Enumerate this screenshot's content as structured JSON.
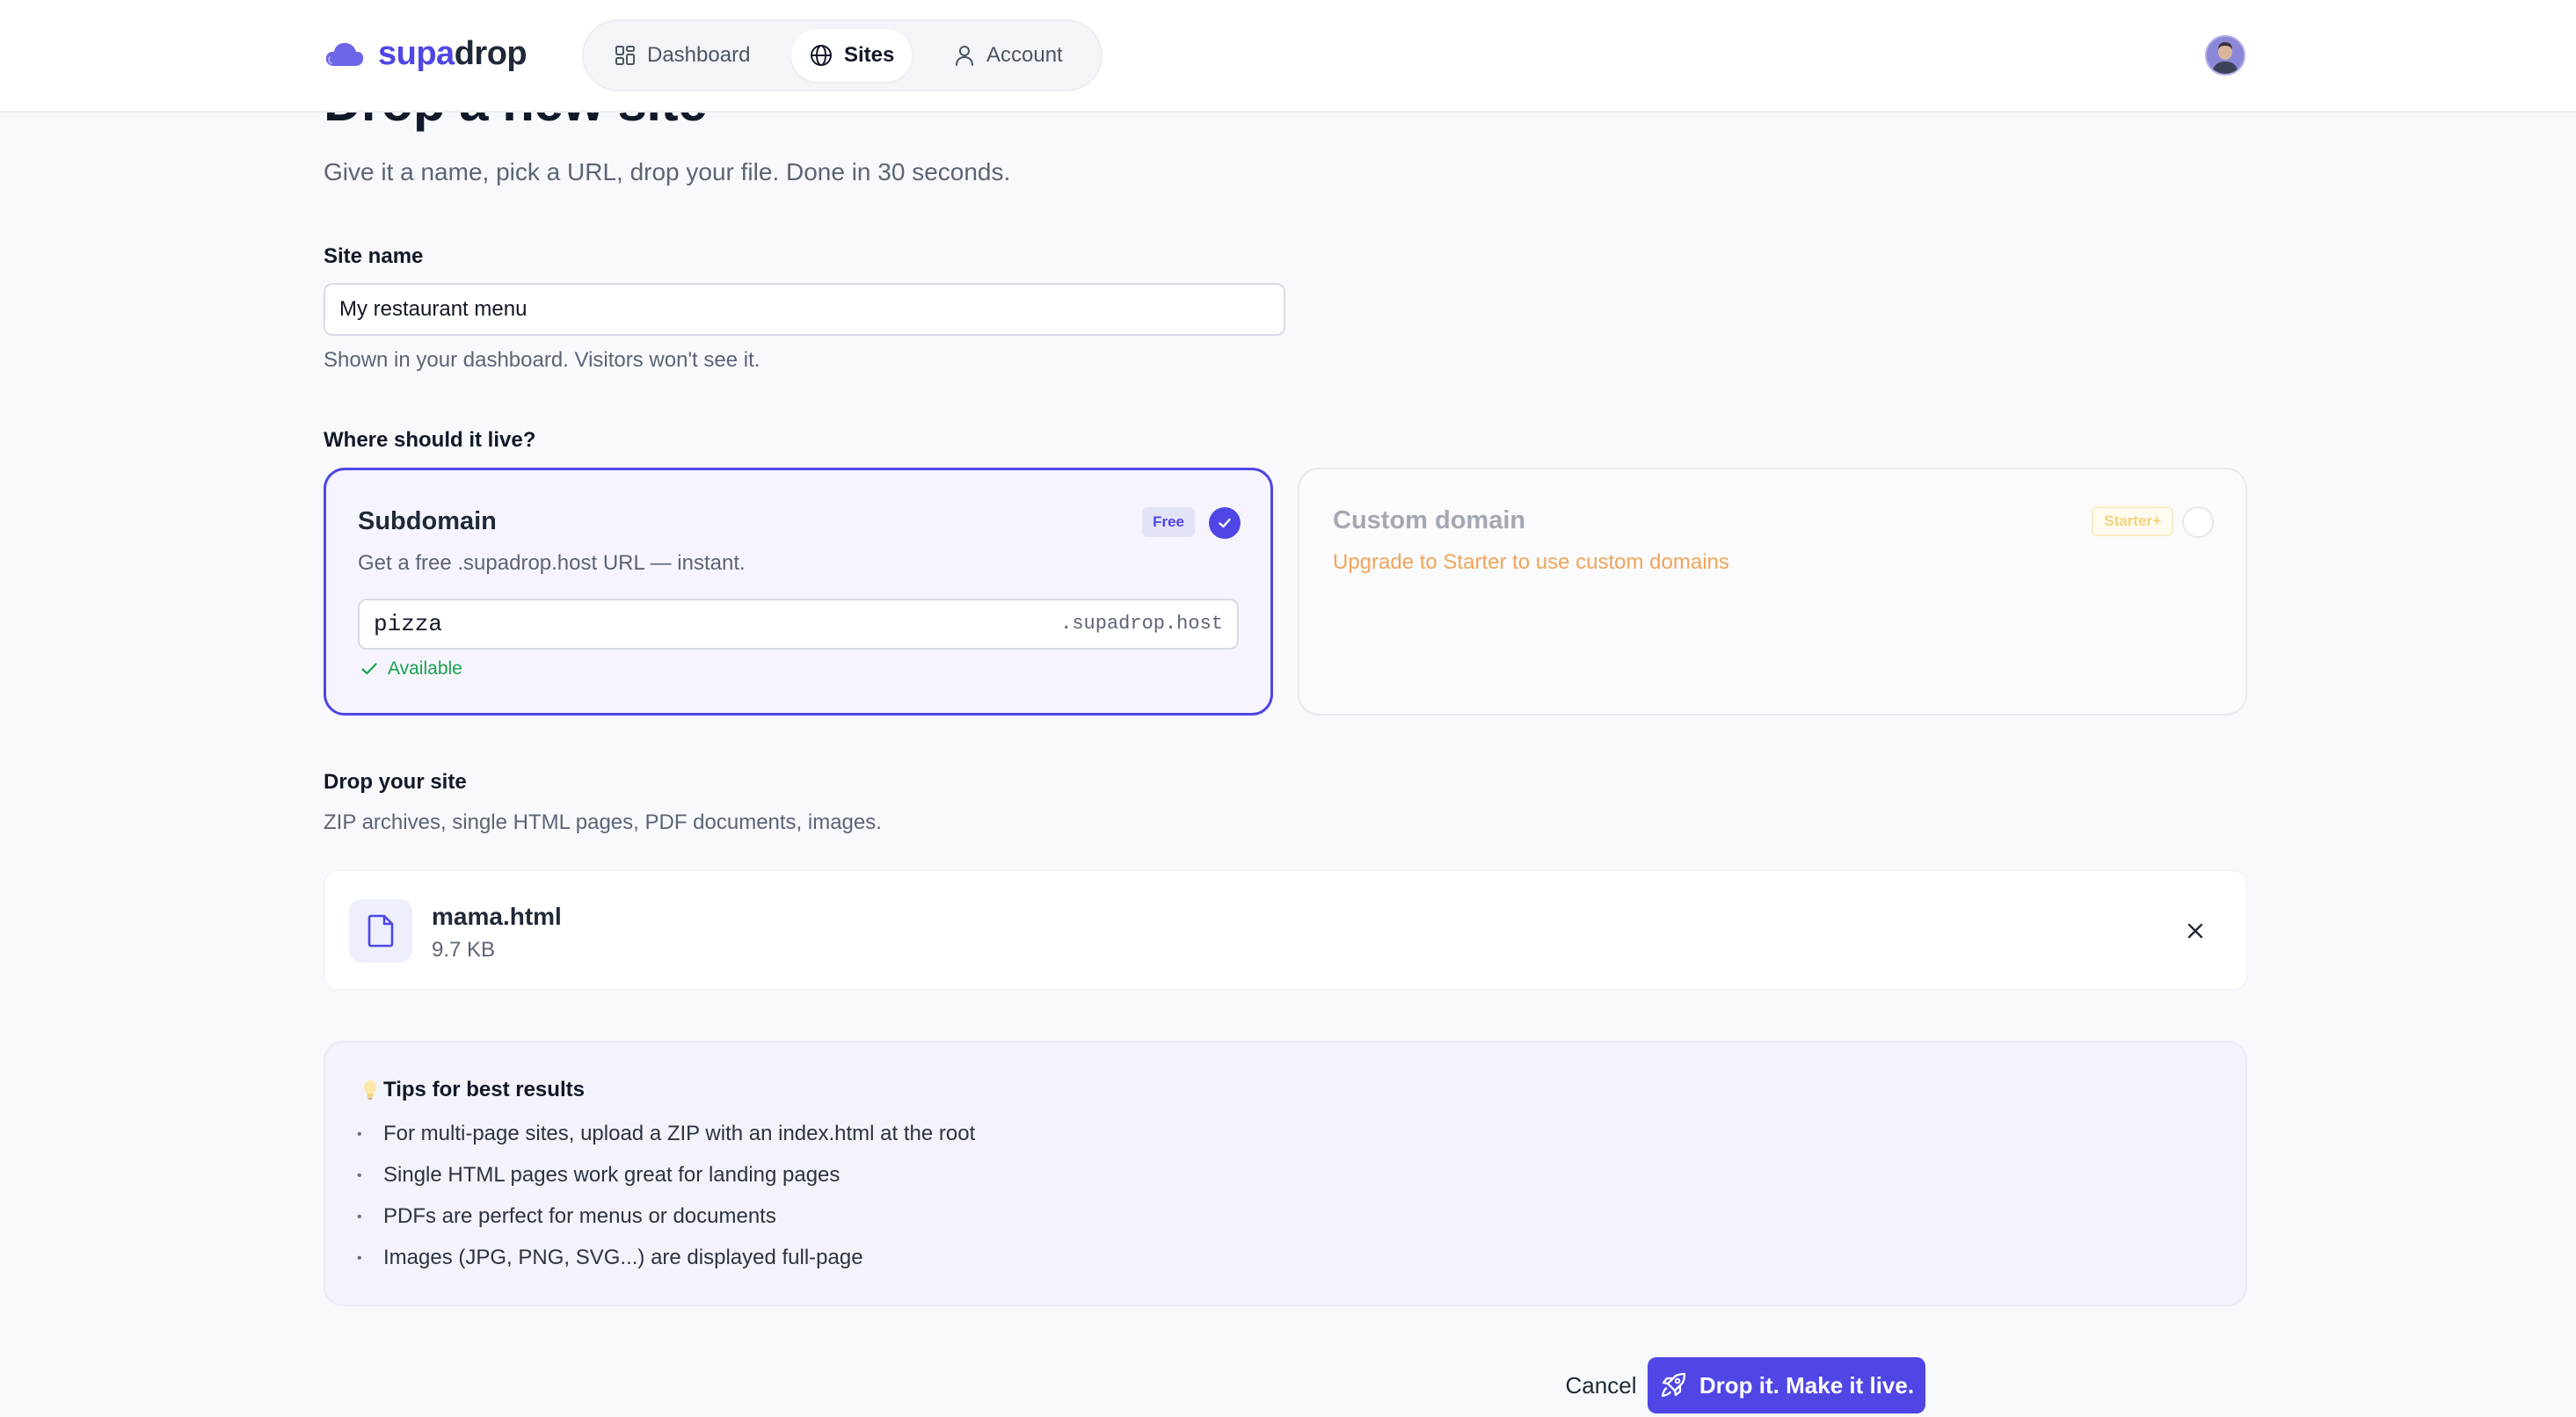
{
  "app": {
    "logo_part_a": "supa",
    "logo_part_b": "drop"
  },
  "nav": {
    "items": [
      {
        "label": "Dashboard",
        "icon": "grid-icon",
        "active": false
      },
      {
        "label": "Sites",
        "icon": "globe-icon",
        "active": true
      },
      {
        "label": "Account",
        "icon": "user-icon",
        "active": false
      }
    ]
  },
  "page": {
    "title": "Drop a new site",
    "subtitle": "Give it a name, pick a URL, drop your file. Done in 30 seconds."
  },
  "site_name": {
    "label": "Site name",
    "value": "My restaurant menu",
    "hint": "Shown in your dashboard. Visitors won't see it."
  },
  "location": {
    "label": "Where should it live?",
    "subdomain": {
      "title": "Subdomain",
      "badge": "Free",
      "description": "Get a free .supadrop.host URL — instant.",
      "value": "pizza",
      "suffix": ".supadrop.host",
      "status": "Available",
      "selected": true
    },
    "custom_domain": {
      "title": "Custom domain",
      "badge": "Starter+",
      "description": "Upgrade to Starter to use custom domains",
      "selected": false
    }
  },
  "upload": {
    "label": "Drop your site",
    "hint": "ZIP archives, single HTML pages, PDF documents, images.",
    "file": {
      "name": "mama.html",
      "size": "9.7 KB"
    }
  },
  "tips": {
    "icon": "lightbulb-icon",
    "title": "Tips for best results",
    "items": [
      "For multi-page sites, upload a ZIP with an index.html at the root",
      "Single HTML pages work great for landing pages",
      "PDFs are perfect for menus or documents",
      "Images (JPG, PNG, SVG...) are displayed full-page"
    ]
  },
  "actions": {
    "cancel": "Cancel",
    "submit": "Drop it. Make it live."
  },
  "colors": {
    "accent": "#4f46e5",
    "success": "#16a34a",
    "upgrade": "#f0a45a",
    "background": "#f8f9fc"
  }
}
